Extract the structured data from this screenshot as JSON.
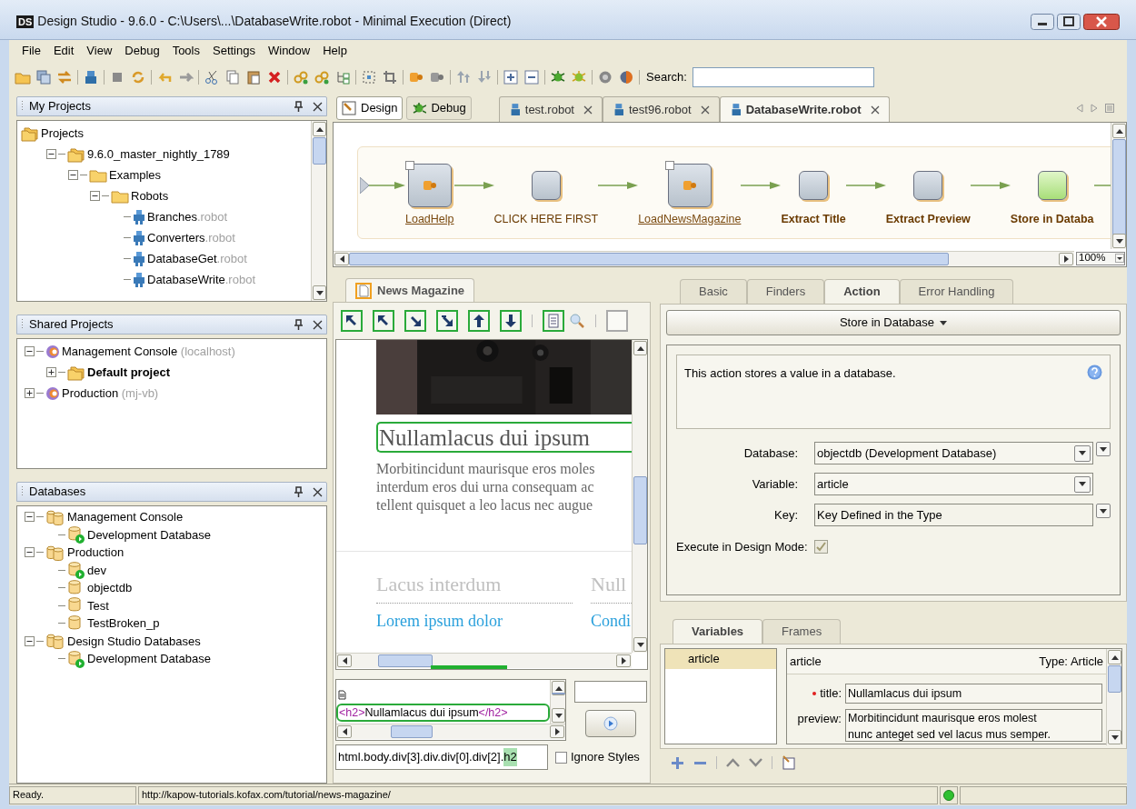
{
  "window": {
    "logo": "DS",
    "title": "Design Studio - 9.6.0 - C:\\Users\\...\\DatabaseWrite.robot - Minimal Execution (Direct)"
  },
  "menu": [
    "File",
    "Edit",
    "View",
    "Debug",
    "Tools",
    "Settings",
    "Window",
    "Help"
  ],
  "toolbar": {
    "search_label": "Search:"
  },
  "my_projects": {
    "title": "My Projects",
    "tree": [
      {
        "name": "Projects",
        "kind": "projects",
        "children": [
          {
            "name": "9.6.0_master_nightly_1789",
            "kind": "projects",
            "expanded": true,
            "children": [
              {
                "name": "Examples",
                "kind": "folder",
                "expanded": true,
                "children": [
                  {
                    "name": "Robots",
                    "kind": "folder",
                    "expanded": true,
                    "children": [
                      {
                        "name": "Branches",
                        "detail": ".robot",
                        "kind": "robot"
                      },
                      {
                        "name": "Converters",
                        "detail": ".robot",
                        "kind": "robot"
                      },
                      {
                        "name": "DatabaseGet",
                        "detail": ".robot",
                        "kind": "robot"
                      },
                      {
                        "name": "DatabaseWrite",
                        "detail": ".robot",
                        "kind": "robot"
                      }
                    ]
                  }
                ]
              }
            ]
          }
        ]
      }
    ]
  },
  "shared_projects": {
    "title": "Shared Projects",
    "tree": [
      {
        "name": "Management Console",
        "detail": "(localhost)",
        "kind": "server",
        "expanded": true,
        "children": [
          {
            "name": "Default project",
            "kind": "projects",
            "expanded": false,
            "default": true
          }
        ]
      },
      {
        "name": "Production",
        "detail": "(mj-vb)",
        "kind": "server",
        "expanded": false
      }
    ]
  },
  "databases": {
    "title": "Databases",
    "tree": [
      {
        "name": "Management Console",
        "kind": "dbgroup",
        "expanded": true,
        "children": [
          {
            "name": "Development Database",
            "kind": "db",
            "running": true
          }
        ]
      },
      {
        "name": "Production",
        "kind": "dbgroup",
        "expanded": true,
        "children": [
          {
            "name": "dev",
            "kind": "db",
            "running": true
          },
          {
            "name": "objectdb",
            "kind": "db",
            "running": false
          },
          {
            "name": "Test",
            "kind": "db",
            "running": false
          },
          {
            "name": "TestBroken_p",
            "kind": "db",
            "running": false
          }
        ]
      },
      {
        "name": "Design Studio Databases",
        "kind": "dbgroup",
        "expanded": true,
        "children": [
          {
            "name": "Development Database",
            "kind": "db",
            "running": true
          }
        ]
      }
    ]
  },
  "modes": [
    {
      "label": "Design",
      "kind": "design",
      "selected": true
    },
    {
      "label": "Debug",
      "kind": "debug",
      "selected": false
    }
  ],
  "file_tabs": [
    {
      "label": "test.robot",
      "selected": false
    },
    {
      "label": "test96.robot",
      "selected": false
    },
    {
      "label": "DatabaseWrite.robot",
      "selected": true
    }
  ],
  "workflow": {
    "zoom": "100%",
    "nodes": [
      {
        "label": "LoadHelp",
        "kind": "group",
        "selected": false
      },
      {
        "label": "CLICK HERE FIRST",
        "kind": "step",
        "selected": false
      },
      {
        "label": "LoadNewsMagazine",
        "kind": "group",
        "selected": false
      },
      {
        "label": "Extract Title",
        "kind": "named",
        "selected": false
      },
      {
        "label": "Extract Preview",
        "kind": "named",
        "selected": false
      },
      {
        "label": "Store in Databa",
        "kind": "named",
        "selected": true
      }
    ]
  },
  "browser": {
    "tab": "News Magazine",
    "page": {
      "heading": "Nullamlacus dui ipsum",
      "paragraph": [
        "Morbitincidunt maurisque eros moles",
        "interdum eros dui urna consequam ac",
        "tellent quisquet a leo lacus nec augue"
      ],
      "columns": [
        {
          "title": "Lacus interdum",
          "link": "Lorem ipsum dolor"
        },
        {
          "title": "Null",
          "link": "Condi"
        }
      ]
    },
    "source": {
      "open_tag": "<h2>",
      "text": "Nullamlacus dui ipsum",
      "close_tag": "</h2>"
    },
    "path": "html.body.div[3].div.div[0].div[2].",
    "path_highlight": "h2",
    "ignore_styles": {
      "label": "Ignore Styles",
      "checked": false
    }
  },
  "properties": {
    "tabs": [
      {
        "label": "Basic",
        "selected": false
      },
      {
        "label": "Finders",
        "selected": false
      },
      {
        "label": "Action",
        "selected": true
      },
      {
        "label": "Error Handling",
        "selected": false
      }
    ],
    "action": "Store in Database",
    "description": "This action stores a value in a database.",
    "fields": [
      {
        "label": "Database:",
        "value": "objectdb (Development Database)",
        "dropdown": true,
        "extra_button": true
      },
      {
        "label": "Variable:",
        "value": "article",
        "dropdown": true,
        "extra_button": false
      },
      {
        "label": "Key:",
        "value": "Key Defined in the Type",
        "dropdown": false,
        "extra_button": true
      }
    ],
    "execute": {
      "label": "Execute in Design Mode:",
      "checked": true,
      "disabled": true
    }
  },
  "variables": {
    "tabs": [
      {
        "label": "Variables",
        "selected": true
      },
      {
        "label": "Frames",
        "selected": false
      }
    ],
    "list": [
      {
        "label": "article",
        "selected": true
      }
    ],
    "detail": {
      "name": "article",
      "type": "Type: Article",
      "fields": [
        {
          "label": "title:",
          "required": true,
          "lines": [
            "Nullamlacus dui ipsum"
          ]
        },
        {
          "label": "preview:",
          "required": false,
          "lines": [
            "Morbitincidunt maurisque eros molest",
            "nunc anteget sed vel lacus mus semper."
          ]
        }
      ]
    }
  },
  "status_bar": {
    "message": "Ready.",
    "url": "http://kapow-tutorials.kofax.com/tutorial/news-magazine/",
    "connected": true
  }
}
